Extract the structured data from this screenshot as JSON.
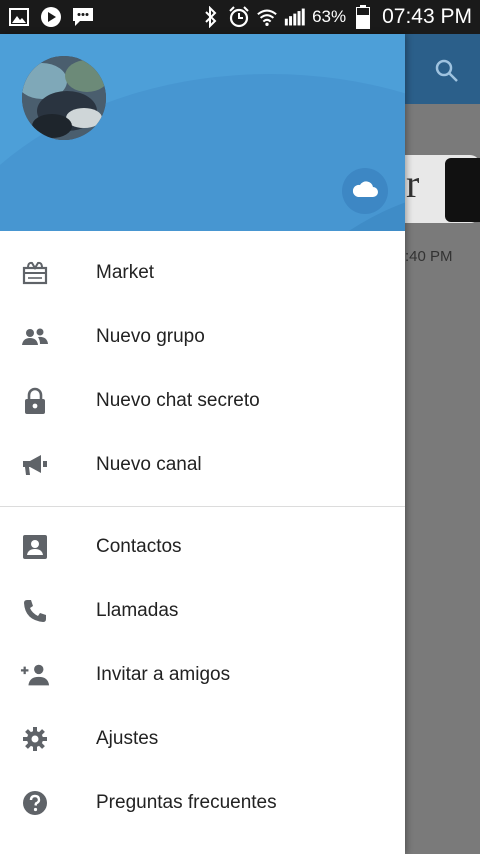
{
  "status_bar": {
    "battery_percent": "63%",
    "time": "07:43 PM",
    "icons": [
      "gallery-icon",
      "play-icon",
      "message-icon",
      "bluetooth-icon",
      "alarm-icon",
      "wifi-icon",
      "signal-icon",
      "battery-icon"
    ]
  },
  "background": {
    "time_fragment": ":40 PM",
    "card_letter": "r"
  },
  "drawer": {
    "header": {
      "user_name": "",
      "user_phone": ""
    },
    "menu_group_1": [
      {
        "label": "Market",
        "icon": "market-icon"
      },
      {
        "label": "Nuevo grupo",
        "icon": "group-icon"
      },
      {
        "label": "Nuevo chat secreto",
        "icon": "lock-icon"
      },
      {
        "label": "Nuevo canal",
        "icon": "megaphone-icon"
      }
    ],
    "menu_group_2": [
      {
        "label": "Contactos",
        "icon": "contact-icon"
      },
      {
        "label": "Llamadas",
        "icon": "phone-icon"
      },
      {
        "label": "Invitar a amigos",
        "icon": "add-person-icon"
      },
      {
        "label": "Ajustes",
        "icon": "gear-icon"
      },
      {
        "label": "Preguntas frecuentes",
        "icon": "help-icon"
      }
    ]
  },
  "colors": {
    "header_blue": "#4d9fd8",
    "appbar_blue": "#2b5f8a",
    "icon_gray": "#5f6368"
  }
}
